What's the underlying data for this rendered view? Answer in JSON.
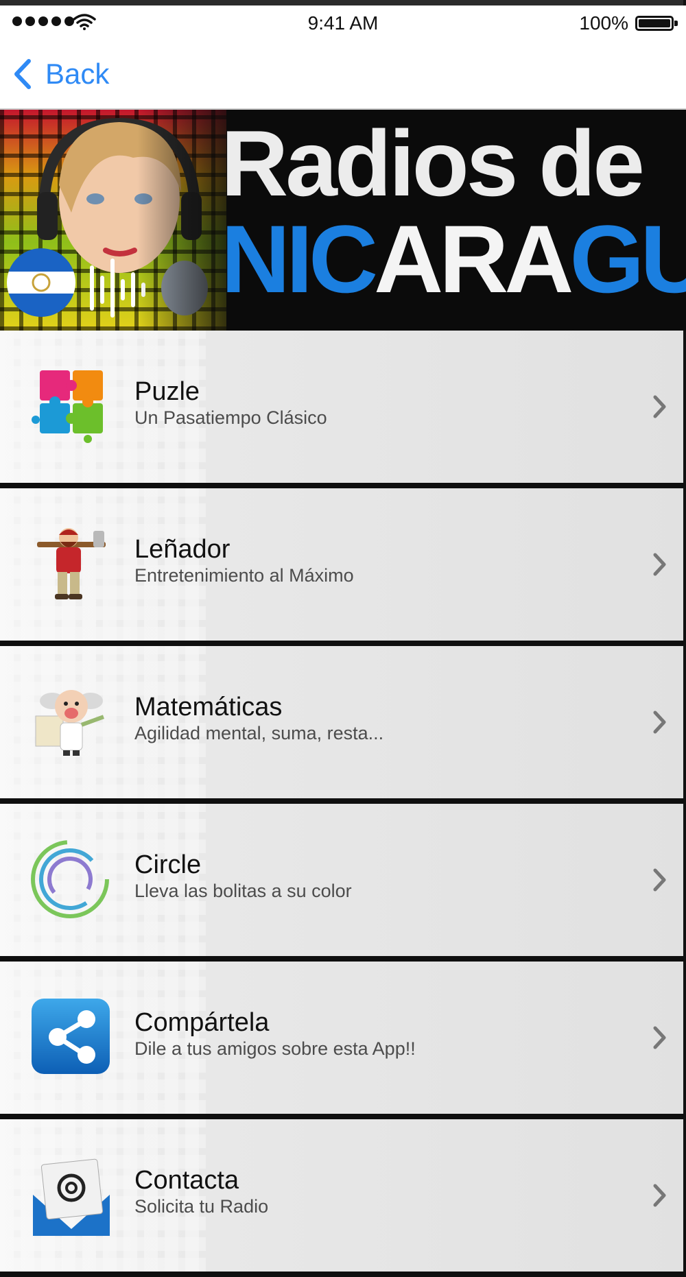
{
  "status_bar": {
    "time": "9:41 AM",
    "battery": "100%",
    "signal_icon": "signal-dots-icon",
    "wifi_icon": "wifi-icon",
    "battery_icon": "battery-icon"
  },
  "nav": {
    "back_label": "Back",
    "back_icon": "chevron-left-icon",
    "accent": "#2f8af5"
  },
  "banner": {
    "line1": "Radios de",
    "line2_parts": [
      "NIC",
      "ARA",
      "GUA"
    ],
    "accent_blue": "#1b7fe0"
  },
  "menu": [
    {
      "title": "Puzle",
      "subtitle": "Un Pasatiempo Clásico",
      "icon": "puzzle-icon"
    },
    {
      "title": "Leñador",
      "subtitle": "Entretenimiento al Máximo",
      "icon": "lumberjack-icon"
    },
    {
      "title": "Matemáticas",
      "subtitle": "Agilidad mental, suma, resta...",
      "icon": "math-professor-icon"
    },
    {
      "title": "Circle",
      "subtitle": "Lleva las bolitas a su color",
      "icon": "circle-game-icon"
    },
    {
      "title": "Compártela",
      "subtitle": "Dile a tus amigos sobre esta App!!",
      "icon": "share-icon"
    },
    {
      "title": "Contacta",
      "subtitle": "Solicita tu Radio",
      "icon": "email-icon"
    }
  ]
}
